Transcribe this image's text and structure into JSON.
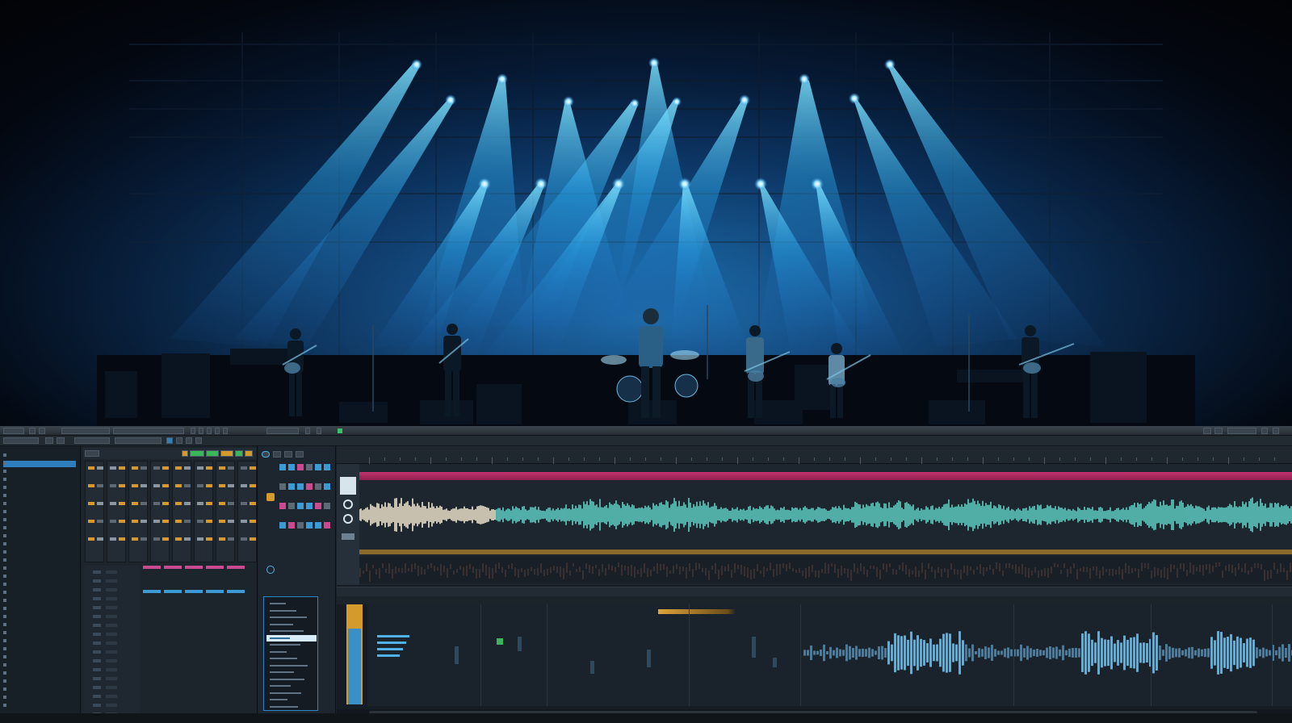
{
  "app": {
    "accent": "#2f7fbf",
    "waveform_color": "#5fd0c6",
    "clip_color": "#c2336e",
    "highlight_color": "#d59a2c"
  },
  "icons": [
    "play-icon",
    "stop-icon",
    "record-icon",
    "loop-icon",
    "metronome-icon",
    "folder-icon",
    "gear-icon"
  ],
  "browser": {
    "items": 32,
    "selected_index": 1
  },
  "inspector": {
    "list_items": 16,
    "selected_index": 5
  },
  "arrange": {
    "playhead_visible": true
  }
}
